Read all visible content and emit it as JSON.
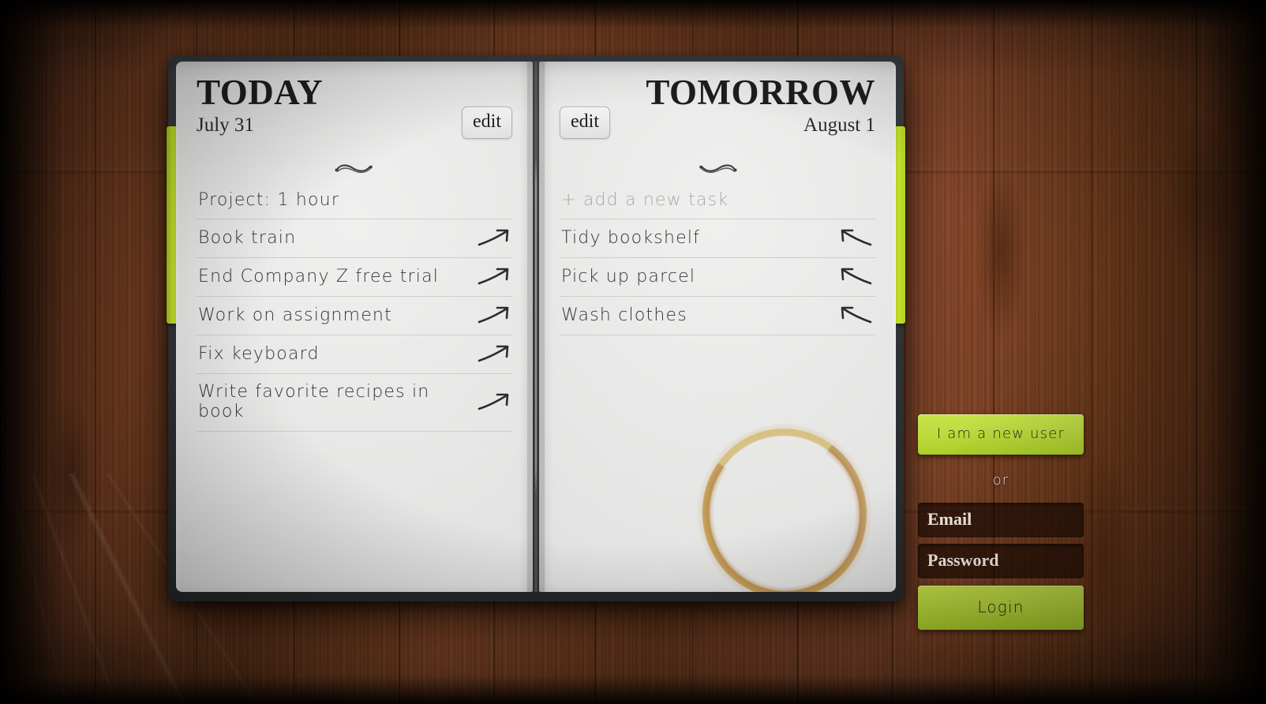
{
  "background": {
    "surface": "wood-desk",
    "wood_color": "#6d3a1e",
    "vignette": true
  },
  "book": {
    "cover_color": "#303336",
    "bookmark_tab_color": "#bedb3f",
    "left_page": {
      "title": "TODAY",
      "date": "July 31",
      "edit_label": "edit",
      "ornament": "swirl-flourish",
      "project_line": "Project: 1 hour",
      "tasks": [
        {
          "label": "Book train",
          "arrow": "arrow-up-right-icon"
        },
        {
          "label": "End Company Z free trial",
          "arrow": "arrow-up-right-icon"
        },
        {
          "label": "Work on assignment",
          "arrow": "arrow-up-right-icon"
        },
        {
          "label": "Fix keyboard",
          "arrow": "arrow-up-right-icon"
        },
        {
          "label": "Write favorite recipes in book",
          "arrow": "arrow-up-right-icon"
        }
      ]
    },
    "right_page": {
      "title": "TOMORROW",
      "date": "August 1",
      "edit_label": "edit",
      "ornament": "swirl-flourish",
      "add_task_placeholder": "+ add a new task",
      "tasks": [
        {
          "label": "Tidy bookshelf",
          "arrow": "arrow-up-left-icon"
        },
        {
          "label": "Pick up parcel",
          "arrow": "arrow-up-left-icon"
        },
        {
          "label": "Wash clothes",
          "arrow": "arrow-up-left-icon"
        }
      ],
      "decoration": "coffee-ring-stain",
      "stain_color": "#ba852a"
    }
  },
  "login": {
    "new_user_label": "I am a new user",
    "or_label": "or",
    "email_placeholder": "Email",
    "email_value": "",
    "password_placeholder": "Password",
    "password_value": "",
    "login_label": "Login",
    "accent_color": "#bedb3f",
    "field_bg": "#1e0c04"
  }
}
